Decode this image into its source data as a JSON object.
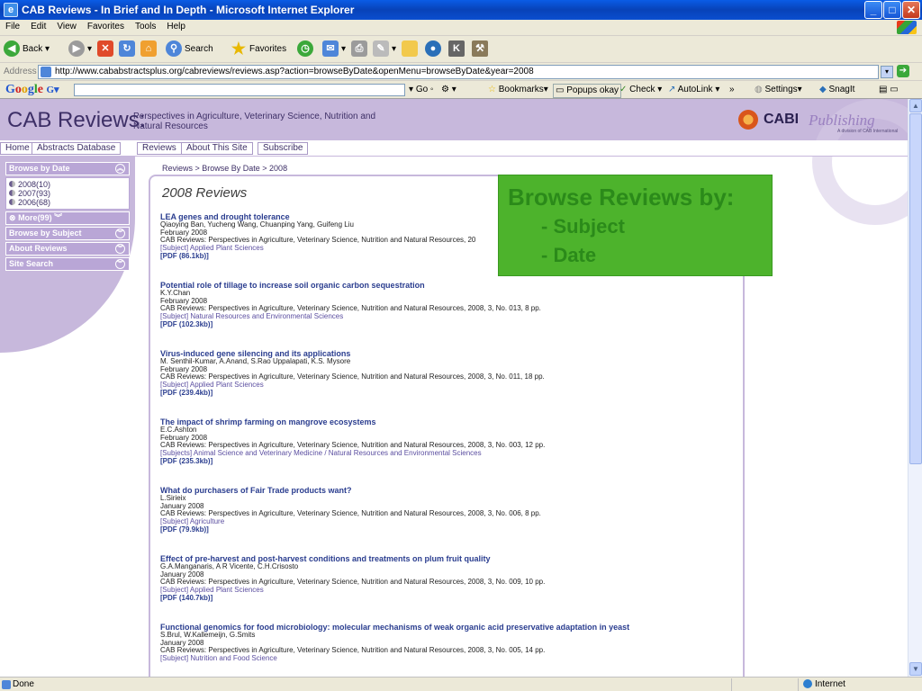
{
  "window": {
    "title": "CAB Reviews - In Brief and In Depth - Microsoft Internet Explorer"
  },
  "menu": [
    "File",
    "Edit",
    "View",
    "Favorites",
    "Tools",
    "Help"
  ],
  "toolbar": {
    "back_label": "Back",
    "search_label": "Search",
    "favorites_label": "Favorites"
  },
  "address": {
    "label": "Address",
    "url": "http://www.cababstractsplus.org/cabreviews/reviews.asp?action=browseByDate&openMenu=browseByDate&year=2008",
    "go_label": "Go"
  },
  "googlebar": {
    "go_label": "Go",
    "bookmarks_label": "Bookmarks▾",
    "popups_label": "Popups okay",
    "check_label": "Check ▾",
    "autolink_label": "AutoLink ▾",
    "more_label": "»",
    "settings_label": "Settings▾",
    "snagit_label": "SnagIt"
  },
  "site": {
    "title": "CAB Reviews:",
    "subtitle": "Perspectives in Agriculture, Veterinary Science, Nutrition and Natural Resources",
    "logo_cabi": "CABI",
    "logo_publishing": "Publishing",
    "logo_division": "A division of CAB International"
  },
  "nav": [
    "Home",
    "Abstracts Database",
    "Reviews",
    "About This Site",
    "Subscribe"
  ],
  "sidebar": {
    "browse_by_date": "Browse by Date",
    "years": [
      "2008(10)",
      "2007(93)",
      "2006(68)"
    ],
    "more": "More(99)",
    "browse_by_subject": "Browse by Subject",
    "about_reviews": "About Reviews",
    "site_search": "Site Search"
  },
  "breadcrumb": "Reviews > Browse By Date > 2008",
  "heading": "2008 Reviews",
  "reviews": [
    {
      "title": "LEA genes and drought tolerance",
      "authors": "Qiaoying Ban, Yucheng Wang, Chuanping Yang, Guifeng Liu",
      "date": "February 2008",
      "citation": "CAB Reviews: Perspectives in Agriculture, Veterinary Science, Nutrition and Natural Resources, 20",
      "subject": "[Subject] Applied Plant Sciences",
      "pdf": "[PDF (86.1kb)]"
    },
    {
      "title": "Potential role of tillage to increase soil organic carbon sequestration",
      "authors": "K.Y.Chan",
      "date": "February 2008",
      "citation": "CAB Reviews: Perspectives in Agriculture, Veterinary Science, Nutrition and Natural Resources, 2008, 3, No. 013, 8 pp.",
      "subject": "[Subject] Natural Resources and Environmental Sciences",
      "pdf": "[PDF (102.3kb)]"
    },
    {
      "title": "Virus-induced gene silencing and its applications",
      "authors": "M. Senthil-Kumar, A.Anand, S.Rao Uppalapati, K.S. Mysore",
      "date": "February 2008",
      "citation": "CAB Reviews: Perspectives in Agriculture, Veterinary Science, Nutrition and Natural Resources, 2008, 3, No. 011, 18 pp.",
      "subject": "[Subject] Applied Plant Sciences",
      "pdf": "[PDF (239.4kb)]"
    },
    {
      "title": "The impact of shrimp farming on mangrove ecosystems",
      "authors": "E.C.Ashton",
      "date": "February 2008",
      "citation": "CAB Reviews: Perspectives in Agriculture, Veterinary Science, Nutrition and Natural Resources, 2008, 3, No. 003, 12 pp.",
      "subject": "[Subjects] Animal Science and Veterinary Medicine / Natural Resources and Environmental Sciences",
      "pdf": "[PDF (235.3kb)]"
    },
    {
      "title": "What do purchasers of Fair Trade products want?",
      "authors": "L.Sirieix",
      "date": "January 2008",
      "citation": "CAB Reviews: Perspectives in Agriculture, Veterinary Science, Nutrition and Natural Resources, 2008, 3, No. 006, 8 pp.",
      "subject": "[Subject] Agriculture",
      "pdf": "[PDF (79.9kb)]"
    },
    {
      "title": "Effect of pre-harvest and post-harvest conditions and treatments on plum fruit quality",
      "authors": "G.A.Manganaris, A R Vicente, C.H.Crisosto",
      "date": "January 2008",
      "citation": "CAB Reviews: Perspectives in Agriculture, Veterinary Science, Nutrition and Natural Resources, 2008, 3, No. 009, 10 pp.",
      "subject": "[Subject] Applied Plant Sciences",
      "pdf": "[PDF (140.7kb)]"
    },
    {
      "title": "Functional genomics for food microbiology: molecular mechanisms of weak organic acid preservative adaptation in yeast",
      "authors": "S.Brul, W.Kallemeijn, G.Smits",
      "date": "January 2008",
      "citation": "CAB Reviews: Perspectives in Agriculture, Veterinary Science, Nutrition and Natural Resources, 2008, 3, No. 005, 14 pp.",
      "subject": "[Subject] Nutrition and Food Science",
      "pdf": ""
    }
  ],
  "callout": {
    "heading": "Browse Reviews by:",
    "items": [
      "- Subject",
      "- Date"
    ]
  },
  "status": {
    "text": "Done",
    "zone": "Internet"
  }
}
